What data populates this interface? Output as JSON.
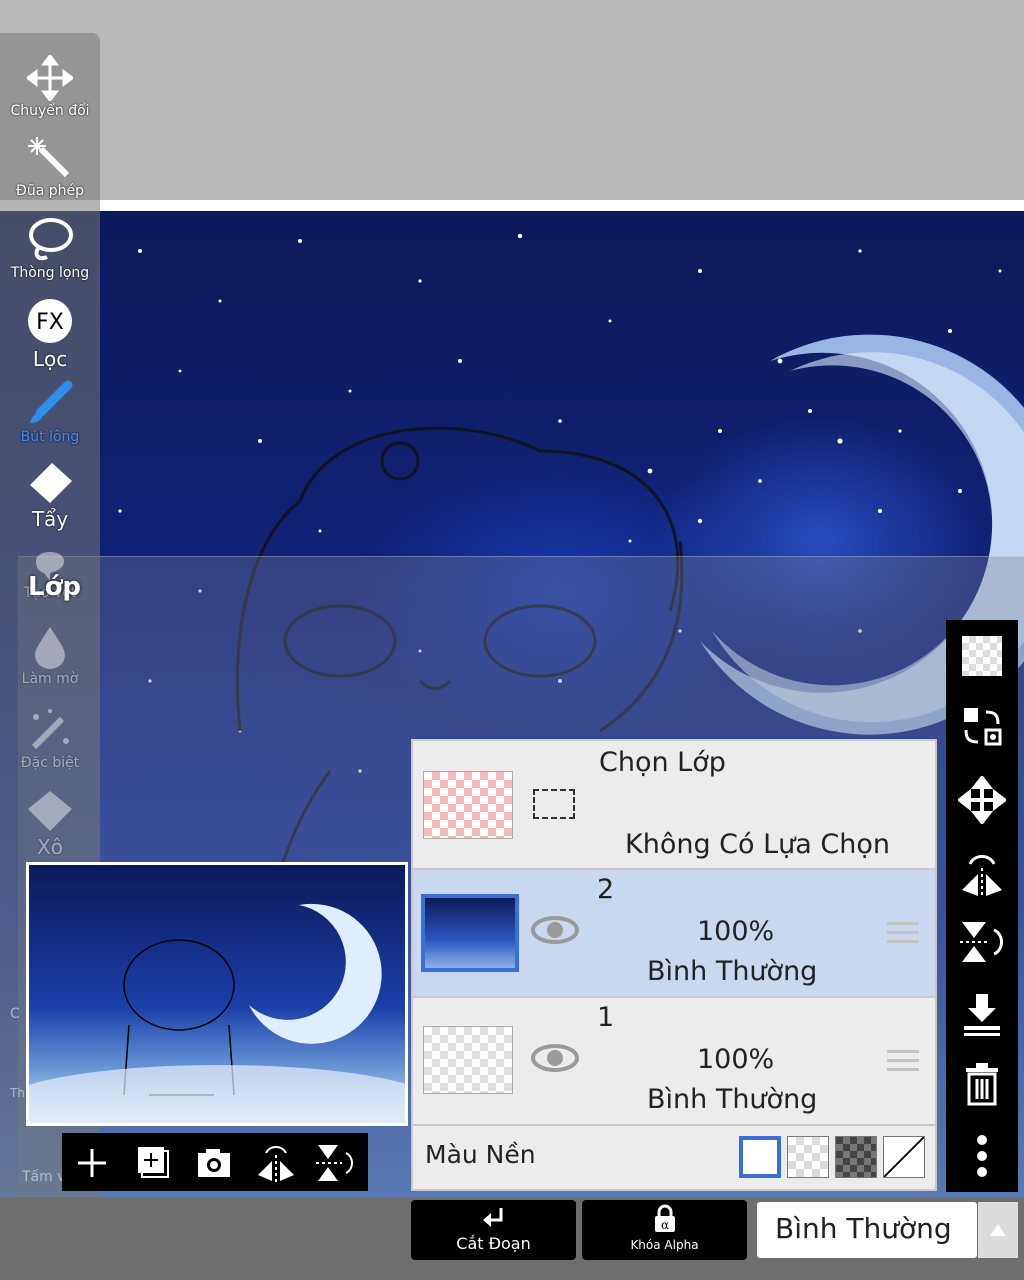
{
  "toolbar": {
    "tools": [
      {
        "id": "transform",
        "label": "Chuyển đổi"
      },
      {
        "id": "magic-wand",
        "label": "Đũa phép"
      },
      {
        "id": "lasso",
        "label": "Thòng lọng"
      },
      {
        "id": "filter",
        "label": "Lọc",
        "icon_text": "FX"
      },
      {
        "id": "brush",
        "label": "Bút lông"
      },
      {
        "id": "eraser",
        "label": "Tẩy"
      },
      {
        "id": "blur",
        "label": "Làm mờ"
      },
      {
        "id": "special",
        "label": "Đặc biệt"
      },
      {
        "id": "fill",
        "label": "Xô"
      }
    ],
    "active_tool": "Bút lông",
    "partial_labels": {
      "smudge": "Tạo vết",
      "c": "C",
      "th": "Th",
      "tam": "Tấm v"
    }
  },
  "layer_panel": {
    "title": "Lớp",
    "selection_row": {
      "title": "Chọn Lớp",
      "status": "Không Có Lựa Chọn"
    },
    "layers": [
      {
        "name": "2",
        "opacity": "100%",
        "blend": "Bình Thường",
        "selected": true,
        "visible": true
      },
      {
        "name": "1",
        "opacity": "100%",
        "blend": "Bình Thường",
        "selected": false,
        "visible": true
      }
    ],
    "background": {
      "label": "Màu Nền",
      "options": [
        "white",
        "checker",
        "dark-checker",
        "none"
      ],
      "selected": "white"
    }
  },
  "preview_toolbar": {
    "icons": [
      "add-layer-icon",
      "add-layer-copy-icon",
      "camera-icon",
      "flip-horizontal-icon",
      "flip-vertical-icon"
    ]
  },
  "right_toolbar": {
    "icons": [
      "checker-icon",
      "swap-icon",
      "move-icon",
      "flip-horizontal-icon",
      "flip-vertical-icon",
      "merge-down-icon",
      "trash-icon",
      "more-icon"
    ]
  },
  "bottom": {
    "clip_label": "Cắt Đoạn",
    "alpha_lock_label": "Khóa Alpha",
    "blend_mode": "Bình Thường"
  },
  "colors": {
    "accent": "#3a6fd8",
    "panel_bg": "#ececec",
    "selected_row": "#c9d8ee"
  }
}
